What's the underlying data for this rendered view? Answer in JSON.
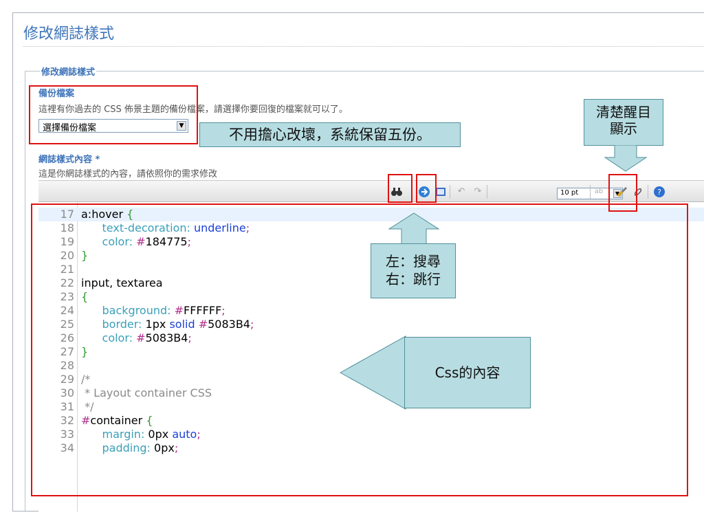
{
  "page": {
    "title": "修改網誌樣式"
  },
  "fieldset": {
    "legend": "修改網誌樣式"
  },
  "backup": {
    "label": "備份檔案",
    "description": "這裡有你過去的 CSS 佈景主題的備份檔案，請選擇你要回復的檔案就可以了。",
    "select_value": "選擇備份檔案"
  },
  "content": {
    "label": "網誌樣式內容 *",
    "description": "這是你網誌樣式的內容，請依照你的需求修改"
  },
  "toolbar": {
    "font_size": "10 pt"
  },
  "callouts": {
    "backup_note": "不用擔心改壞，系統保留五份。",
    "highlight_line1": "清楚醒目",
    "highlight_line2": "顯示",
    "search_line1": "左：搜尋",
    "search_line2": "右：跳行",
    "css_content": "Css的內容"
  },
  "code_lines": [
    {
      "n": "17",
      "t": "a:hover {"
    },
    {
      "n": "18",
      "t": "      text-decoration: underline;"
    },
    {
      "n": "19",
      "t": "      color: #184775;"
    },
    {
      "n": "20",
      "t": "}"
    },
    {
      "n": "21",
      "t": ""
    },
    {
      "n": "22",
      "t": "input, textarea"
    },
    {
      "n": "23",
      "t": "{"
    },
    {
      "n": "24",
      "t": "      background: #FFFFFF;"
    },
    {
      "n": "25",
      "t": "      border: 1px solid #5083B4;"
    },
    {
      "n": "26",
      "t": "      color: #5083B4;"
    },
    {
      "n": "27",
      "t": "}"
    },
    {
      "n": "28",
      "t": ""
    },
    {
      "n": "29",
      "t": "/*"
    },
    {
      "n": "30",
      "t": " * Layout container CSS"
    },
    {
      "n": "31",
      "t": " */"
    },
    {
      "n": "32",
      "t": "#container {"
    },
    {
      "n": "33",
      "t": "      margin: 0px auto;"
    },
    {
      "n": "34",
      "t": "      padding: 0px;"
    }
  ],
  "colors": {
    "title_blue": "#3f74b9",
    "annotation_red": "#e01010",
    "callout_fill": "#b7dde2"
  }
}
